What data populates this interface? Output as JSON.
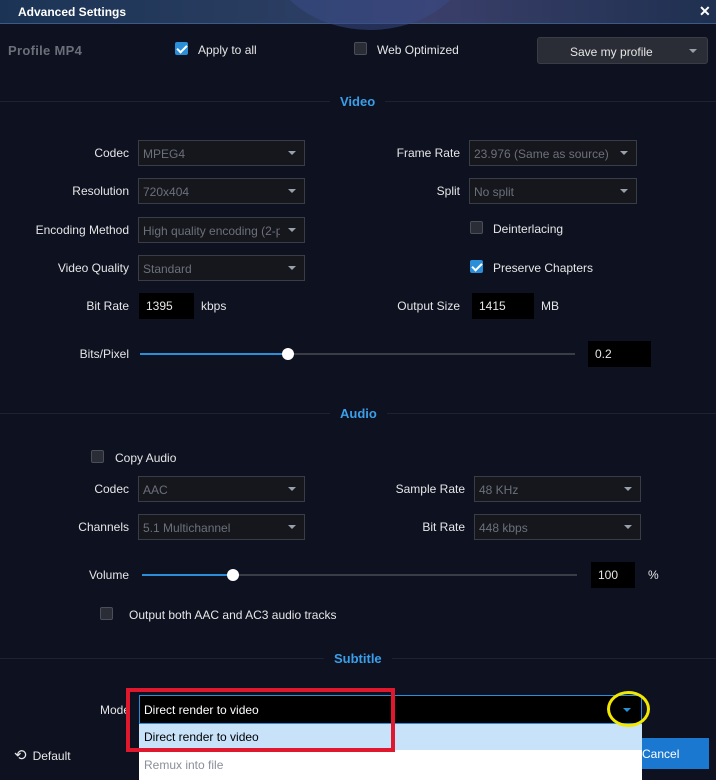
{
  "window": {
    "title": "Advanced Settings",
    "close_glyph": "✕"
  },
  "top": {
    "profile_label": "Profile  MP4",
    "apply_all": {
      "label": "Apply to all",
      "checked": true
    },
    "web_optimized": {
      "label": "Web Optimized",
      "checked": false
    },
    "save_profile_label": "Save my profile"
  },
  "sections": {
    "video": "Video",
    "audio": "Audio",
    "subtitle": "Subtitle"
  },
  "video": {
    "codec": {
      "label": "Codec",
      "value": "MPEG4"
    },
    "resolution": {
      "label": "Resolution",
      "value": "720x404"
    },
    "encoding_method": {
      "label": "Encoding Method",
      "value": "High quality encoding (2-p"
    },
    "video_quality": {
      "label": "Video Quality",
      "value": "Standard"
    },
    "bit_rate": {
      "label": "Bit Rate",
      "value": "1395",
      "unit": "kbps"
    },
    "frame_rate": {
      "label": "Frame Rate",
      "value": "23.976 (Same as source)"
    },
    "split": {
      "label": "Split",
      "value": "No split"
    },
    "deinterlacing": {
      "label": "Deinterlacing",
      "checked": false
    },
    "preserve_chapters": {
      "label": "Preserve Chapters",
      "checked": true
    },
    "output_size": {
      "label": "Output Size",
      "value": "1415",
      "unit": "MB"
    },
    "bits_pixel": {
      "label": "Bits/Pixel",
      "value": "0.2",
      "slider_fraction": 0.34
    }
  },
  "audio": {
    "copy_audio": {
      "label": "Copy Audio",
      "checked": false
    },
    "codec": {
      "label": "Codec",
      "value": "AAC"
    },
    "channels": {
      "label": "Channels",
      "value": "5.1 Multichannel"
    },
    "sample_rate": {
      "label": "Sample Rate",
      "value": "48 KHz"
    },
    "bit_rate": {
      "label": "Bit Rate",
      "value": "448 kbps"
    },
    "volume": {
      "label": "Volume",
      "value": "100",
      "unit": "%",
      "slider_fraction": 0.21
    },
    "both_tracks": {
      "label": "Output both AAC and AC3 audio tracks",
      "checked": false
    }
  },
  "subtitle": {
    "mode_label": "Mode",
    "mode_value": "Direct render to video",
    "options": [
      "Direct render to video",
      "Remux into file"
    ]
  },
  "footer": {
    "default_label": "Default",
    "cancel_label": "Cancel"
  },
  "annotations": {
    "red_box_color": "#e0182d",
    "yellow_circle_color": "#f3e800"
  },
  "colors": {
    "accent": "#2a8fd8",
    "background": "#0d1120"
  },
  "icons": {
    "checkbox_checked": "check-icon",
    "dropdown": "chevron-down-icon",
    "reset": "undo-icon",
    "close": "close-icon"
  }
}
